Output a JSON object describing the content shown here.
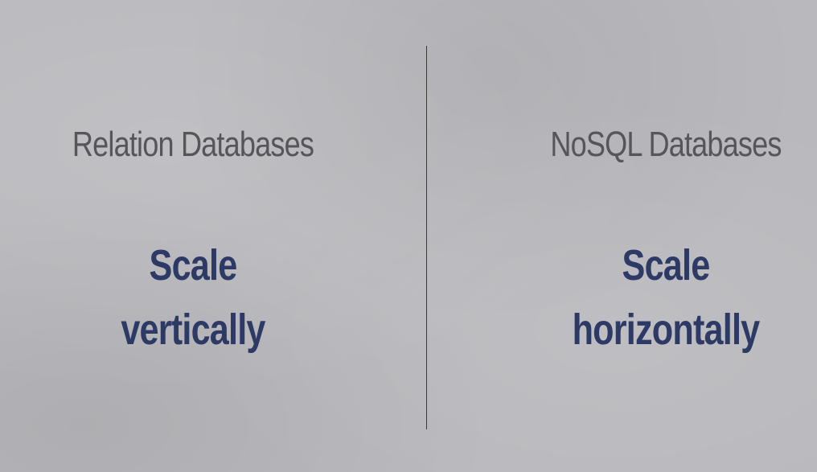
{
  "slide": {
    "left": {
      "heading": "Relation Databases",
      "point_line1": "Scale",
      "point_line2": "vertically"
    },
    "right": {
      "heading": "NoSQL Databases",
      "point_line1": "Scale",
      "point_line2": "horizontally"
    }
  },
  "colors": {
    "heading_text": "#55555a",
    "point_text": "#2e3a66",
    "divider": "#3a3a3a"
  }
}
